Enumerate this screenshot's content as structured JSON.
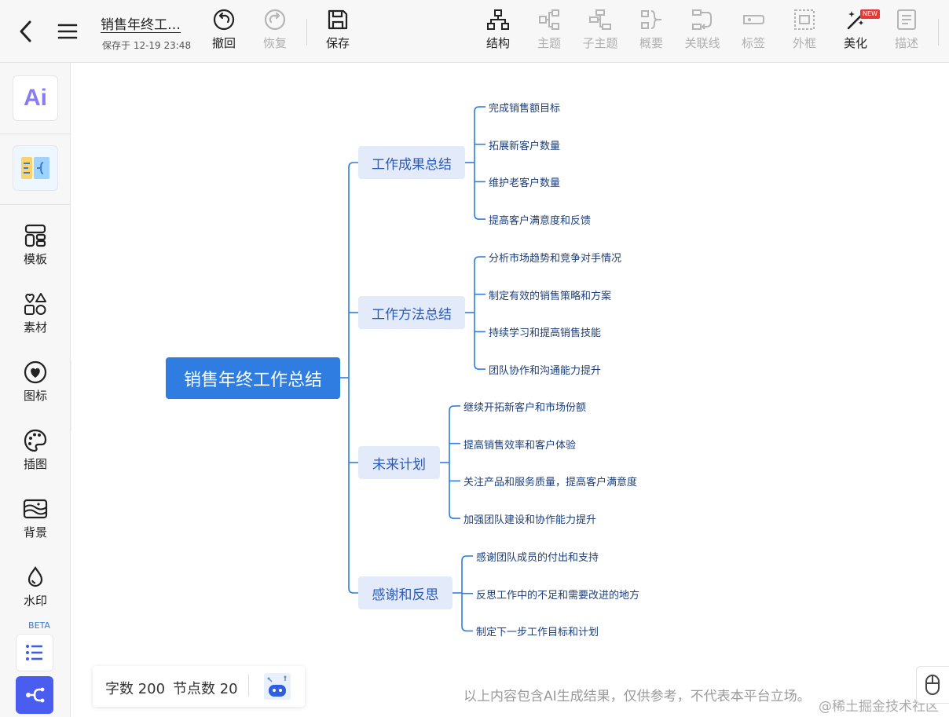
{
  "header": {
    "doc_title": "销售年终工…",
    "saved_text": "保存于 12-19 23:48",
    "undo_label": "撤回",
    "redo_label": "恢复",
    "save_label": "保存",
    "tools": [
      {
        "label": "结构",
        "icon": "structure-icon",
        "enabled": true
      },
      {
        "label": "主题",
        "icon": "topic-icon",
        "enabled": false
      },
      {
        "label": "子主题",
        "icon": "subtopic-icon",
        "enabled": false
      },
      {
        "label": "概要",
        "icon": "summary-icon",
        "enabled": false
      },
      {
        "label": "关联线",
        "icon": "relation-line-icon",
        "enabled": false
      },
      {
        "label": "标签",
        "icon": "tag-icon",
        "enabled": false
      },
      {
        "label": "外框",
        "icon": "boundary-icon",
        "enabled": false
      },
      {
        "label": "美化",
        "icon": "magic-wand-icon",
        "enabled": true
      },
      {
        "label": "描述",
        "icon": "description-icon",
        "enabled": false
      }
    ],
    "new_badge": "NEW"
  },
  "sidebar": {
    "ai_label": "Ai",
    "items": [
      {
        "label": "模板",
        "icon": "template-icon"
      },
      {
        "label": "素材",
        "icon": "shapes-icon"
      },
      {
        "label": "图标",
        "icon": "heart-icon"
      },
      {
        "label": "插图",
        "icon": "palette-icon"
      },
      {
        "label": "背景",
        "icon": "background-icon"
      },
      {
        "label": "水印",
        "icon": "watermark-drop-icon"
      }
    ],
    "beta_label": "BETA"
  },
  "mindmap": {
    "root": "销售年终工作总结",
    "branches": [
      {
        "label": "工作成果总结",
        "children": [
          "完成销售额目标",
          "拓展新客户数量",
          "维护老客户数量",
          "提高客户满意度和反馈"
        ]
      },
      {
        "label": "工作方法总结",
        "children": [
          "分析市场趋势和竞争对手情况",
          "制定有效的销售策略和方案",
          "持续学习和提高销售技能",
          "团队协作和沟通能力提升"
        ]
      },
      {
        "label": "未来计划",
        "children": [
          "继续开拓新客户和市场份额",
          "提高销售效率和客户体验",
          "关注产品和服务质量，提高客户满意度",
          "加强团队建设和协作能力提升"
        ]
      },
      {
        "label": "感谢和反思",
        "children": [
          "感谢团队成员的付出和支持",
          "反思工作中的不足和需要改进的地方",
          "制定下一步工作目标和计划"
        ]
      }
    ],
    "colors": {
      "root_bg": "#2f7de1",
      "branch_bg": "#e3ebfb",
      "branch_text": "#2a5bb8",
      "line": "#2f7de1"
    }
  },
  "stats": {
    "word_count": "字数 200",
    "node_count": "节点数 20"
  },
  "footer": {
    "disclaimer": "以上内容包含AI生成结果，仅供参考，不代表本平台立场。",
    "watermark": "@稀土掘金技术社区"
  }
}
